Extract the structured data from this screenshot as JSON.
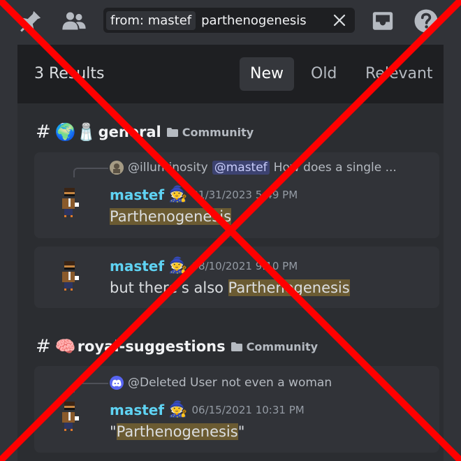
{
  "toolbar": {
    "search_key": "from:",
    "search_value": "mastef",
    "search_query": "parthenogenesis"
  },
  "results": {
    "count_label": "3 Results",
    "sort_tabs": [
      {
        "label": "New",
        "active": true
      },
      {
        "label": "Old",
        "active": false
      },
      {
        "label": "Relevant",
        "active": false
      }
    ]
  },
  "groups": [
    {
      "channel_emoji": "🌍🧂",
      "channel_name": "general",
      "category": "Community",
      "messages": [
        {
          "reply_user": "@illuminosity",
          "reply_mention": "@mastef",
          "reply_text": "How does a single ...",
          "author": "mastef",
          "timestamp": "01/31/2023 5:49 PM",
          "body_before": "",
          "body_highlight": "Parthenogenesis",
          "body_after": ""
        },
        {
          "author": "mastef",
          "timestamp": "08/10/2021 9:10 PM",
          "body_before": "but there's also ",
          "body_highlight": "Parthenogenesis",
          "body_after": ""
        }
      ]
    },
    {
      "channel_emoji": "🧠",
      "channel_name": "royal-suggestions",
      "category": "Community",
      "messages": [
        {
          "reply_user": "@Deleted User",
          "reply_text": "not even a woman",
          "author": "mastef",
          "timestamp": "06/15/2021 10:31 PM",
          "body_before": "\"",
          "body_highlight": "Parthenogenesis",
          "body_after": "\""
        }
      ]
    }
  ],
  "icons": [
    "pin-icon",
    "members-icon",
    "clear-icon",
    "inbox-icon",
    "help-icon",
    "folder-icon",
    "discord-logo-icon",
    "wizard-emoji"
  ],
  "colors": {
    "author": "#5fd3f3",
    "highlight": "#6b5b32",
    "mention_bg": "#3c4270",
    "overlay_x": "#ff0000",
    "panel_bg": "#2b2d31"
  }
}
